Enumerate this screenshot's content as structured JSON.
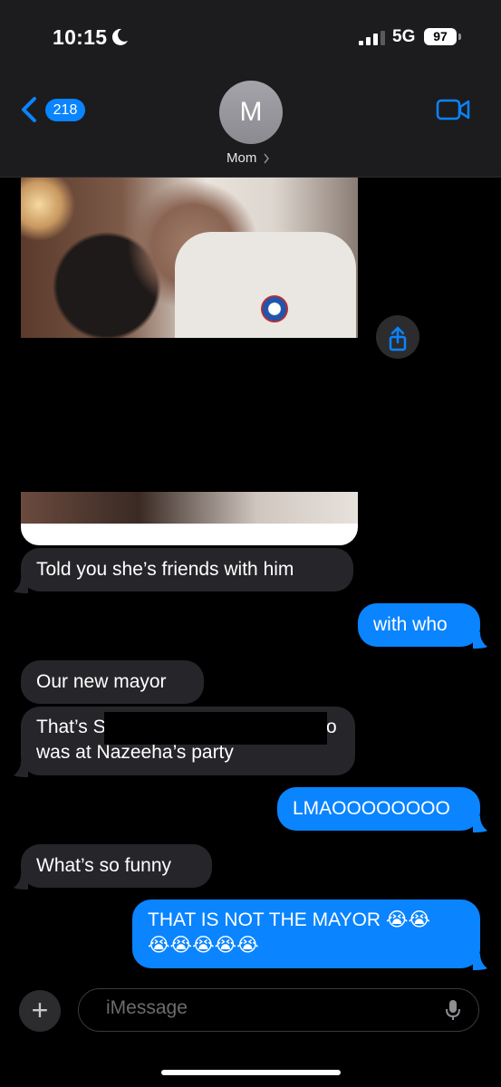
{
  "status_bar": {
    "time": "10:15",
    "network": "5G",
    "battery": "97"
  },
  "header": {
    "back_count": "218",
    "avatar_initial": "M",
    "contact_name": "Mom"
  },
  "messages": [
    {
      "direction": "incoming",
      "text": "Told you she’s friends with him"
    },
    {
      "direction": "outgoing",
      "text": "with who"
    },
    {
      "direction": "incoming",
      "text": "Our new mayor"
    },
    {
      "direction": "incoming",
      "line1": "That’s S",
      "line1_end": "o",
      "line2": "was at Nazeeha’s party"
    },
    {
      "direction": "outgoing",
      "text": "LMAOOOOOOOO"
    },
    {
      "direction": "incoming",
      "text": "What’s so funny"
    },
    {
      "direction": "outgoing",
      "line1": "THAT IS NOT THE MAYOR 😭😭",
      "line2": "😭😭😭😭😭"
    }
  ],
  "composer": {
    "placeholder": "iMessage"
  },
  "colors": {
    "outgoing_bubble": "#0a84ff",
    "incoming_bubble": "#26262a",
    "background": "#000000"
  },
  "icons": [
    "moon-icon",
    "signal-icon",
    "back-chevron-icon",
    "video-call-icon",
    "share-icon",
    "plus-icon",
    "microphone-icon"
  ]
}
